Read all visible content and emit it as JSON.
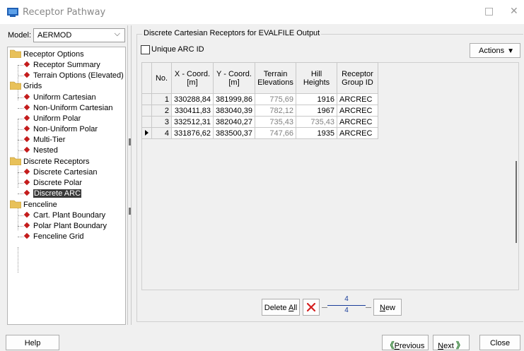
{
  "window": {
    "title": "Receptor Pathway",
    "maximize_glyph": "□",
    "close_glyph": "✕"
  },
  "model": {
    "label": "Model:",
    "value": "AERMOD"
  },
  "tree": {
    "receptor_options": {
      "label": "Receptor Options",
      "items": [
        "Receptor Summary",
        "Terrain Options (Elevated)"
      ]
    },
    "grids": {
      "label": "Grids",
      "items": [
        "Uniform Cartesian",
        "Non-Uniform Cartesian",
        "Uniform Polar",
        "Non-Uniform Polar",
        "Multi-Tier",
        "Nested"
      ]
    },
    "discrete": {
      "label": "Discrete Receptors",
      "items": [
        "Discrete Cartesian",
        "Discrete Polar",
        "Discrete ARC"
      ]
    },
    "fenceline": {
      "label": "Fenceline",
      "items": [
        "Cart. Plant Boundary",
        "Polar Plant Boundary",
        "Fenceline Grid"
      ]
    },
    "selected": "Discrete ARC"
  },
  "panel": {
    "title": "Discrete Cartesian Receptors for EVALFILE Output",
    "unique_arc_label": "Unique ARC ID",
    "actions_label": "Actions",
    "columns": [
      "No.",
      "X - Coord.\n[m]",
      "Y - Coord.\n[m]",
      "Terrain\nElevations",
      "Hill\nHeights",
      "Receptor\nGroup ID"
    ],
    "rows": [
      {
        "no": "1",
        "x": "330288,84",
        "y": "381999,86",
        "terrain": "775,69",
        "hill": "1916",
        "group": "ARCREC"
      },
      {
        "no": "2",
        "x": "330411,83",
        "y": "383040,39",
        "terrain": "782,12",
        "hill": "1967",
        "group": "ARCREC"
      },
      {
        "no": "3",
        "x": "332512,31",
        "y": "382040,27",
        "terrain": "735,43",
        "hill": "735,43",
        "group": "ARCREC"
      },
      {
        "no": "4",
        "x": "331876,62",
        "y": "383500,37",
        "terrain": "747,66",
        "hill": "1935",
        "group": "ARCREC"
      }
    ],
    "delete_all_prefix": "Delete ",
    "delete_all_underlined": "A",
    "delete_all_suffix": "ll",
    "counter_current": "4",
    "counter_total": "4",
    "new_underlined": "N",
    "new_suffix": "ew"
  },
  "footer": {
    "help": "Help",
    "previous_underlined": "P",
    "previous_suffix": "revious",
    "next_underlined": "N",
    "next_suffix": "ext",
    "close": "Close"
  },
  "colors": {
    "bullet": "#c41c1c",
    "folder": "#e8c15a",
    "counter": "#1a3d9a",
    "chevron": "#2e7d32"
  }
}
